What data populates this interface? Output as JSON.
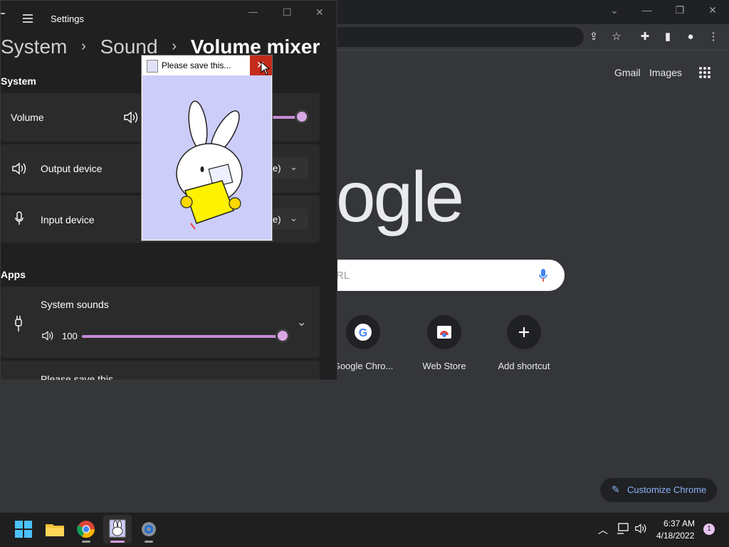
{
  "chrome": {
    "top_links": {
      "gmail": "Gmail",
      "images": "Images"
    },
    "logo_visible": "ogle",
    "search_placeholder_visible": "RL",
    "shortcuts": [
      {
        "label": "Google Chro...",
        "icon": "google-g-icon"
      },
      {
        "label": "Web Store",
        "icon": "web-store-icon"
      },
      {
        "label": "Add shortcut",
        "icon": "plus-icon"
      }
    ],
    "customize_label": "Customize Chrome"
  },
  "settings": {
    "app_title": "Settings",
    "breadcrumb": {
      "item1": "System",
      "sep": "›",
      "item2": "Sound",
      "item3": "Volume mixer"
    },
    "section_system": "System",
    "volume_label": "Volume",
    "output_device_label": "Output device",
    "output_device_value_visible": "e)",
    "input_device_label": "Input device",
    "input_device_value_visible": "e)",
    "section_apps": "Apps",
    "system_sounds_label": "System sounds",
    "system_sounds_value": "100",
    "system_sounds_level": 1.0,
    "next_item_partial": "Please save this..."
  },
  "popup": {
    "title": "Please save this...",
    "close_color": "#c42b1c",
    "background_color": "#cccdf9"
  },
  "taskbar": {
    "time": "6:37 AM",
    "date": "4/18/2022",
    "notification_count": "1"
  },
  "colors": {
    "accent_slider": "#c58ad6",
    "chrome_bg": "#35363a",
    "settings_bg": "#202020"
  }
}
